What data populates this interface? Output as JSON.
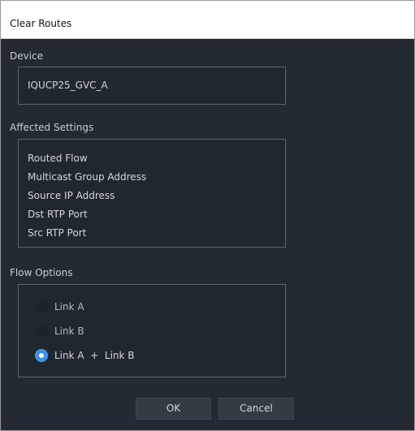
{
  "window": {
    "title": "Clear Routes"
  },
  "device": {
    "label": "Device",
    "value": "IQUCP25_GVC_A"
  },
  "affected_settings": {
    "label": "Affected Settings",
    "items": [
      "Routed Flow",
      "Multicast Group Address",
      "Source IP Address",
      "Dst RTP Port",
      "Src RTP Port"
    ]
  },
  "flow_options": {
    "label": "Flow Options",
    "options": [
      {
        "label": "Link A",
        "selected": false
      },
      {
        "label": "Link B",
        "selected": false
      },
      {
        "label": "Link A  +  Link B",
        "selected": true
      }
    ]
  },
  "buttons": {
    "ok": "OK",
    "cancel": "Cancel"
  },
  "colors": {
    "background": "#232a33",
    "accent": "#3a8ee6",
    "titlebar": "#ffffff"
  }
}
